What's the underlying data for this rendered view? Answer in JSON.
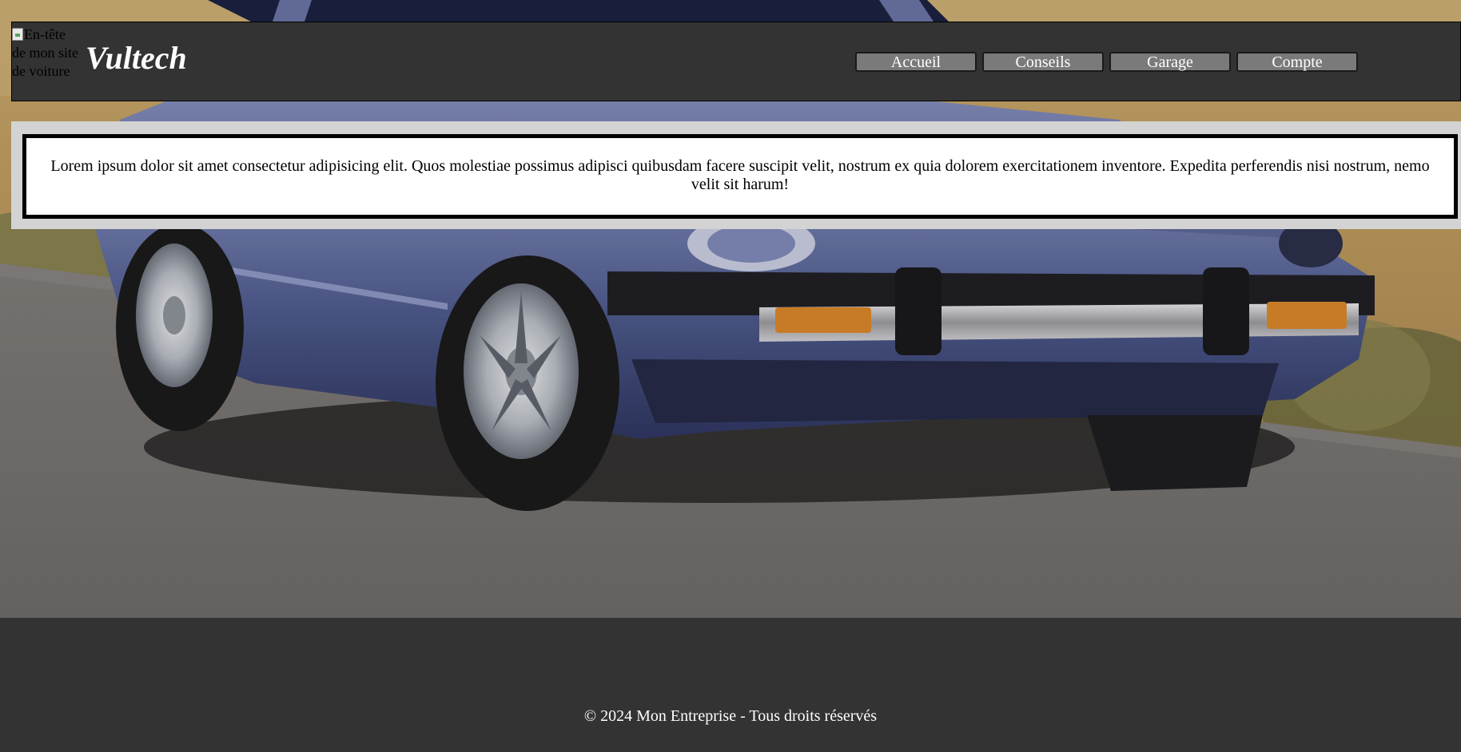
{
  "header": {
    "logo_alt": "En-tête de mon site de voiture",
    "site_title": "Vultech",
    "background_color": "#333333"
  },
  "nav": {
    "items": [
      {
        "label": "Accueil"
      },
      {
        "label": "Conseils"
      },
      {
        "label": "Garage"
      },
      {
        "label": "Compte"
      }
    ],
    "button_color": "#7a7a7a"
  },
  "content": {
    "text": "Lorem ipsum dolor sit amet consectetur adipisicing elit. Quos molestiae possimus adipisci quibusdam facere suscipit velit, nostrum ex quia dolorem exercitationem inventore. Expedita perferendis nisi nostrum, nemo velit sit harum!",
    "panel_color": "#d3d3d3",
    "box_color": "#ffffff"
  },
  "hero": {
    "image_name": "blue-sports-car-photo"
  },
  "footer": {
    "text": "© 2024 Mon Entreprise - Tous droits réservés"
  }
}
